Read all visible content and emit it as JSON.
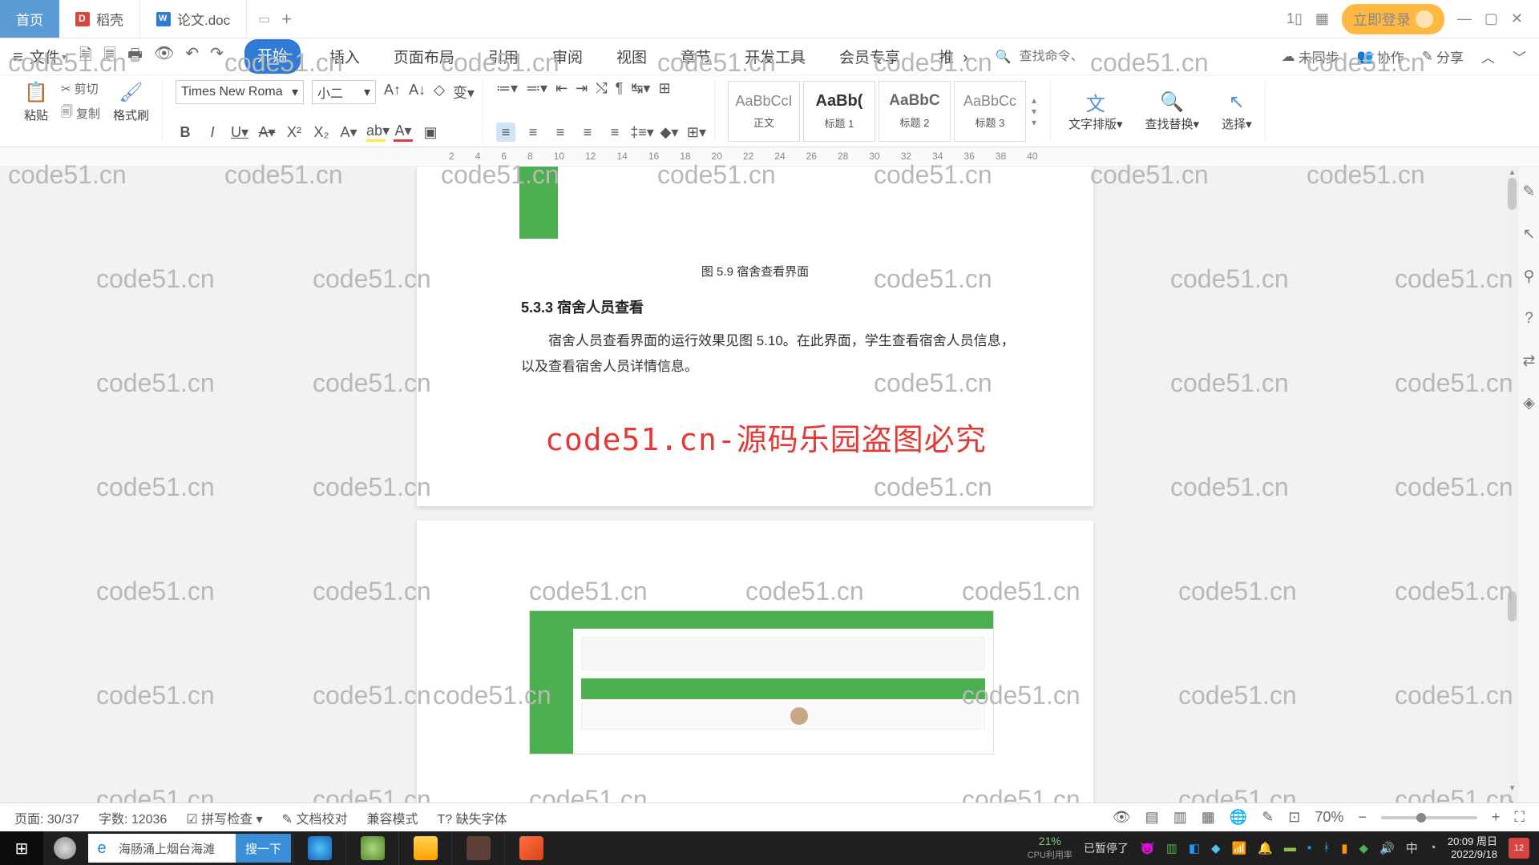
{
  "tabs": {
    "home": "首页",
    "docker": "稻壳",
    "doc": "论文.doc"
  },
  "win": {
    "login": "立即登录"
  },
  "menu": {
    "file": "文件",
    "items": [
      "开始",
      "插入",
      "页面布局",
      "引用",
      "审阅",
      "视图",
      "章节",
      "开发工具",
      "会员专享",
      "推"
    ],
    "search_icon_label": "🔍",
    "search_ph": "查找命令、搜索模板",
    "right": {
      "unsync": "未同步",
      "coop": "协作",
      "share": "分享"
    }
  },
  "ribbon": {
    "paste": "粘贴",
    "cut": "剪切",
    "copy": "复制",
    "fmtbrush": "格式刷",
    "font": "Times New Roma",
    "size": "小二",
    "styles": {
      "body": "正文",
      "h1": "标题 1",
      "h2": "标题 2",
      "h3": "标题 3",
      "preview": "AaBbCcI",
      "preview_b": "AaBb(",
      "preview_c": "AaBbC",
      "preview_d": "AaBbCc"
    },
    "textdir": "文字排版",
    "findrep": "查找替换",
    "select": "选择"
  },
  "ruler": [
    "2",
    "4",
    "6",
    "8",
    "10",
    "12",
    "14",
    "16",
    "18",
    "20",
    "22",
    "24",
    "26",
    "28",
    "30",
    "32",
    "34",
    "36",
    "38",
    "40"
  ],
  "doc": {
    "caption": "图 5.9  宿舍查看界面",
    "heading": "5.3.3  宿舍人员查看",
    "body_a": "宿舍人员查看界面的运行效果见图 5.10。在此界面，学生查看宿舍人员信息，",
    "body_b": "以及查看宿舍人员详情信息。",
    "big_wm": "code51.cn-源码乐园盗图必究"
  },
  "wm": "code51.cn",
  "status": {
    "page": "页面: 30/37",
    "words": "字数: 12036",
    "spell": "拼写检查",
    "proof": "文档校对",
    "compat": "兼容模式",
    "missfont": "缺失字体",
    "zoom": "70%"
  },
  "task": {
    "search": "海肠涌上烟台海滩",
    "go": "搜一下",
    "pct": "21%",
    "cpu": "CPU利用率",
    "paused": "已暂停了",
    "time": "20:09 周日",
    "date": "2022/9/18",
    "notif": "12",
    "ime": "中"
  }
}
